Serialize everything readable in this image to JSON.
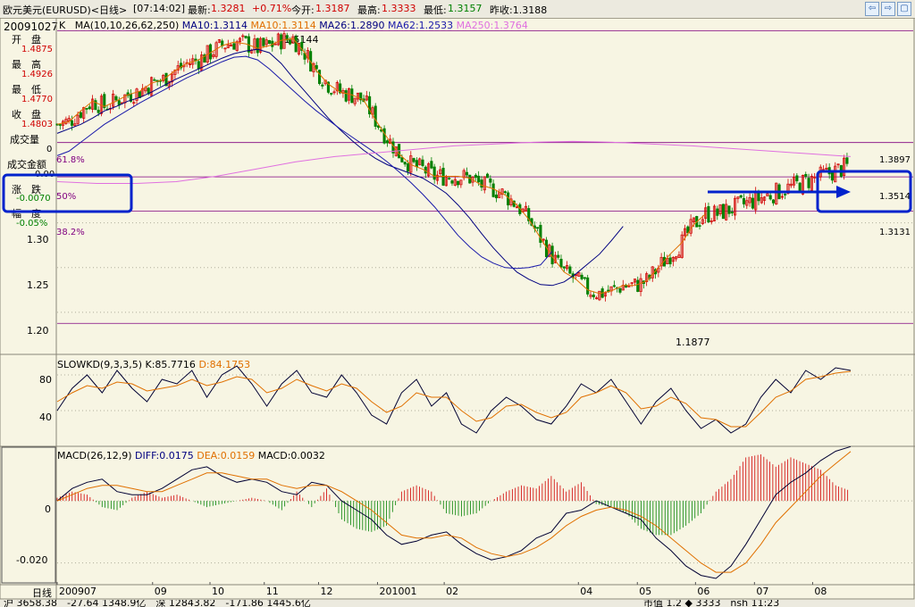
{
  "titlebar": {
    "pair": "欧元美元(EURUSD)<日线>",
    "time": "[07:14:02]",
    "latest_label": "最新:",
    "latest": "1.3281",
    "change": "+0.71%",
    "open_label": "今开:",
    "open": "1.3187",
    "high_label": "最高:",
    "high": "1.3333",
    "low_label": "最低:",
    "low": "1.3157",
    "prev_close": "昨收:1.3188",
    "buttons": [
      "⇦",
      "⇨",
      "▢"
    ]
  },
  "info_panel": {
    "date": "20091027",
    "rows": [
      {
        "label": "开　盘",
        "value": "1.4875"
      },
      {
        "label": "最　高",
        "value": "1.4926"
      },
      {
        "label": "最　低",
        "value": "1.4770"
      },
      {
        "label": "收　盘",
        "value": "1.4803"
      },
      {
        "label": "成交量",
        "value": "0"
      },
      {
        "label": "成交金额",
        "value": "0.00"
      },
      {
        "label": "涨　跌",
        "value": "-0.0070"
      },
      {
        "label": "幅　度",
        "value": "-0.05%"
      }
    ]
  },
  "main_legend": {
    "k": "K",
    "ma_params": "MA(10,10,26,62,250)",
    "items": [
      {
        "text": "MA10:1.3114",
        "color": "#000080"
      },
      {
        "text": "MA10:1.3114",
        "color": "#e07000"
      },
      {
        "text": "MA26:1.2890",
        "color": "#000080"
      },
      {
        "text": "MA62:1.2533",
        "color": "#1a1aaa"
      },
      {
        "text": "MA250:1.3764",
        "color": "#e070e0"
      }
    ]
  },
  "fib_labels": {
    "f618": "61.8%",
    "f50": "50%",
    "f382": "38.2%",
    "v618": "1.3897",
    "v50": "1.3514",
    "v382": "1.3131"
  },
  "annotations": {
    "high": "1.5144",
    "low": "1.1877"
  },
  "slowkd_legend": {
    "name": "SLOWKD(9,3,3,5)",
    "k": "K:85.7716",
    "d": "D:84.1753"
  },
  "macd_legend": {
    "name": "MACD(26,12,9)",
    "diff": "DIFF:0.0175",
    "dea": "DEA:0.0159",
    "macd": "MACD:0.0032"
  },
  "date_axis": {
    "label": "日线",
    "ticks": [
      {
        "text": "200907",
        "pos": 0.0
      },
      {
        "text": "09",
        "pos": 0.123
      },
      {
        "text": "10",
        "pos": 0.197
      },
      {
        "text": "11",
        "pos": 0.267
      },
      {
        "text": "12",
        "pos": 0.337
      },
      {
        "text": "201001",
        "pos": 0.413
      },
      {
        "text": "02",
        "pos": 0.499
      },
      {
        "text": "04",
        "pos": 0.672
      },
      {
        "text": "05",
        "pos": 0.748
      },
      {
        "text": "06",
        "pos": 0.823
      },
      {
        "text": "07",
        "pos": 0.899
      },
      {
        "text": "08",
        "pos": 0.974
      }
    ]
  },
  "status_bar": {
    "left": "沪 3658.38　-27.64 1348.9亿　深 12843.82　-171.86 1445.6亿",
    "right": "市值 1.2 ◆ 3333　nsh 11:23"
  },
  "colors": {
    "up": "#d00000",
    "down": "#008000",
    "ma10": "#e07000",
    "ma26": "#000080",
    "ma62": "#1a1aaa",
    "ma250": "#e070e0",
    "fib": "#800080",
    "highlight": "#0022cc",
    "kd_k": "#000033",
    "kd_d": "#e07000",
    "macd_diff": "#000033",
    "macd_dea": "#e07000"
  },
  "chart_data": [
    {
      "type": "line",
      "title": "欧元美元(EURUSD) 日线 K / MA",
      "x_range": [
        "2009-07",
        "2010-08"
      ],
      "y_ticks": [
        1.2,
        1.25,
        1.3
      ],
      "ylim": [
        1.172,
        1.525
      ],
      "x": [
        0,
        4,
        8,
        12,
        16,
        20,
        24,
        28,
        32,
        36,
        40,
        44,
        48,
        52,
        56,
        60,
        64,
        68,
        72,
        76,
        80,
        84,
        88,
        92,
        96,
        100,
        104,
        108,
        112,
        116,
        120,
        124,
        128,
        132,
        136,
        140,
        144,
        148,
        152,
        156,
        160,
        164,
        168,
        172,
        176,
        180,
        184,
        188,
        192,
        196,
        200,
        204,
        208,
        212,
        216,
        220,
        224,
        228,
        232,
        236,
        240,
        244,
        248,
        252,
        256,
        260,
        264,
        268,
        272,
        276,
        280
      ],
      "series": [
        {
          "name": "MA10",
          "values": [
            1.41,
            1.413,
            1.425,
            1.436,
            1.43,
            1.436,
            1.443,
            1.447,
            1.456,
            1.46,
            1.47,
            1.478,
            1.482,
            1.49,
            1.498,
            1.502,
            1.5,
            1.495,
            1.498,
            1.504,
            1.506,
            1.49,
            1.47,
            1.455,
            1.446,
            1.443,
            1.437,
            1.415,
            1.395,
            1.377,
            1.365,
            1.36,
            1.352,
            1.352,
            1.352,
            1.35,
            1.342,
            1.338,
            1.331,
            1.32,
            1.304,
            1.283,
            1.262,
            1.245,
            1.237,
            1.225,
            1.221,
            1.224,
            1.23,
            1.23,
            1.235,
            1.25,
            1.265,
            1.278,
            1.298,
            1.31
          ]
        },
        {
          "name": "MA26",
          "values": [
            1.4,
            1.405,
            1.41,
            1.417,
            1.425,
            1.43,
            1.436,
            1.44,
            1.446,
            1.453,
            1.46,
            1.466,
            1.472,
            1.478,
            1.484,
            1.489,
            1.492,
            1.494,
            1.49,
            1.478,
            1.462,
            1.447,
            1.432,
            1.417,
            1.404,
            1.392,
            1.381,
            1.372,
            1.365,
            1.36,
            1.355,
            1.35,
            1.342,
            1.333,
            1.32,
            1.305,
            1.288,
            1.272,
            1.258,
            1.245,
            1.237,
            1.231,
            1.23,
            1.234,
            1.243,
            1.254,
            1.265,
            1.28,
            1.296
          ]
        },
        {
          "name": "MA62",
          "values": [
            1.375,
            1.38,
            1.39,
            1.4,
            1.41,
            1.418,
            1.426,
            1.434,
            1.441,
            1.448,
            1.455,
            1.462,
            1.468,
            1.474,
            1.48,
            1.485,
            1.486,
            1.482,
            1.472,
            1.46,
            1.448,
            1.436,
            1.425,
            1.415,
            1.405,
            1.396,
            1.387,
            1.378,
            1.368,
            1.357,
            1.345,
            1.332,
            1.318,
            1.302,
            1.286,
            1.273,
            1.262,
            1.255,
            1.25,
            1.249,
            1.25,
            1.253,
            1.268
          ]
        },
        {
          "name": "MA250",
          "values": [
            1.346,
            1.344,
            1.344,
            1.346,
            1.352,
            1.36,
            1.368,
            1.374,
            1.378,
            1.382,
            1.386,
            1.388,
            1.39,
            1.391,
            1.39,
            1.388,
            1.386,
            1.383,
            1.38,
            1.377,
            1.374
          ]
        }
      ],
      "fib_levels": [
        1.3897,
        1.3514,
        1.3131
      ],
      "extremes": {
        "high": 1.5144,
        "low": 1.1877
      }
    },
    {
      "type": "line",
      "title": "SLOWKD(9,3,3,5)",
      "y_ticks": [
        40,
        80
      ],
      "ylim": [
        0,
        100
      ],
      "series": [
        {
          "name": "K",
          "values": [
            40,
            65,
            80,
            60,
            85,
            65,
            50,
            75,
            70,
            85,
            55,
            80,
            90,
            70,
            45,
            70,
            85,
            60,
            55,
            80,
            60,
            35,
            25,
            60,
            75,
            45,
            60,
            25,
            15,
            40,
            55,
            45,
            30,
            25,
            45,
            70,
            60,
            75,
            50,
            25,
            50,
            65,
            40,
            20,
            30,
            15,
            25,
            55,
            75,
            60,
            85,
            75,
            88,
            85
          ]
        },
        {
          "name": "D",
          "values": [
            50,
            60,
            68,
            65,
            72,
            70,
            62,
            65,
            68,
            75,
            68,
            72,
            78,
            75,
            60,
            65,
            75,
            68,
            62,
            70,
            65,
            50,
            38,
            45,
            60,
            55,
            55,
            40,
            28,
            32,
            45,
            47,
            38,
            32,
            38,
            55,
            60,
            68,
            60,
            42,
            45,
            55,
            48,
            32,
            30,
            22,
            22,
            38,
            55,
            62,
            75,
            78,
            82,
            84
          ]
        }
      ]
    },
    {
      "type": "bar",
      "title": "MACD(26,12,9)",
      "y_ticks": [
        0,
        -0.02
      ],
      "ylim": [
        -0.027,
        0.017
      ],
      "series": [
        {
          "name": "DIFF",
          "values": [
            0.0,
            0.004,
            0.006,
            0.007,
            0.003,
            0.002,
            0.002,
            0.004,
            0.007,
            0.01,
            0.011,
            0.008,
            0.006,
            0.007,
            0.006,
            0.003,
            0.002,
            0.006,
            0.005,
            0.0,
            -0.003,
            -0.006,
            -0.011,
            -0.014,
            -0.013,
            -0.011,
            -0.01,
            -0.014,
            -0.017,
            -0.019,
            -0.018,
            -0.016,
            -0.012,
            -0.01,
            -0.004,
            -0.003,
            -0.0,
            -0.002,
            -0.004,
            -0.006,
            -0.012,
            -0.016,
            -0.021,
            -0.024,
            -0.025,
            -0.021,
            -0.014,
            -0.006,
            0.002,
            0.006,
            0.009,
            0.013,
            0.016,
            0.0175
          ]
        },
        {
          "name": "DEA",
          "values": [
            0.0,
            0.002,
            0.004,
            0.005,
            0.005,
            0.004,
            0.003,
            0.003,
            0.005,
            0.007,
            0.009,
            0.009,
            0.008,
            0.007,
            0.007,
            0.005,
            0.004,
            0.005,
            0.005,
            0.003,
            0.0,
            -0.003,
            -0.007,
            -0.011,
            -0.012,
            -0.012,
            -0.011,
            -0.012,
            -0.015,
            -0.017,
            -0.018,
            -0.017,
            -0.015,
            -0.012,
            -0.008,
            -0.005,
            -0.003,
            -0.002,
            -0.003,
            -0.005,
            -0.008,
            -0.012,
            -0.016,
            -0.02,
            -0.023,
            -0.023,
            -0.02,
            -0.014,
            -0.007,
            -0.002,
            0.003,
            0.008,
            0.012,
            0.0159
          ]
        },
        {
          "name": "MACD",
          "values": [
            0.001,
            0.003,
            0.002,
            -0.002,
            -0.003,
            0.001,
            0.003,
            0.001,
            0.002,
            0.0,
            -0.002,
            -0.001,
            0.0,
            0.001,
            0.0,
            -0.003,
            0.003,
            -0.002,
            0.004,
            -0.006,
            -0.009,
            -0.01,
            -0.008,
            0.003,
            0.005,
            0.003,
            -0.004,
            -0.005,
            -0.004,
            0.0,
            0.003,
            0.005,
            0.004,
            0.008,
            0.003,
            0.006,
            -0.001,
            -0.002,
            -0.004,
            -0.009,
            -0.011,
            -0.011,
            -0.008,
            -0.004,
            0.003,
            0.007,
            0.014,
            0.015,
            0.011,
            0.014,
            0.012,
            0.01,
            0.005,
            0.0032
          ]
        }
      ]
    }
  ]
}
